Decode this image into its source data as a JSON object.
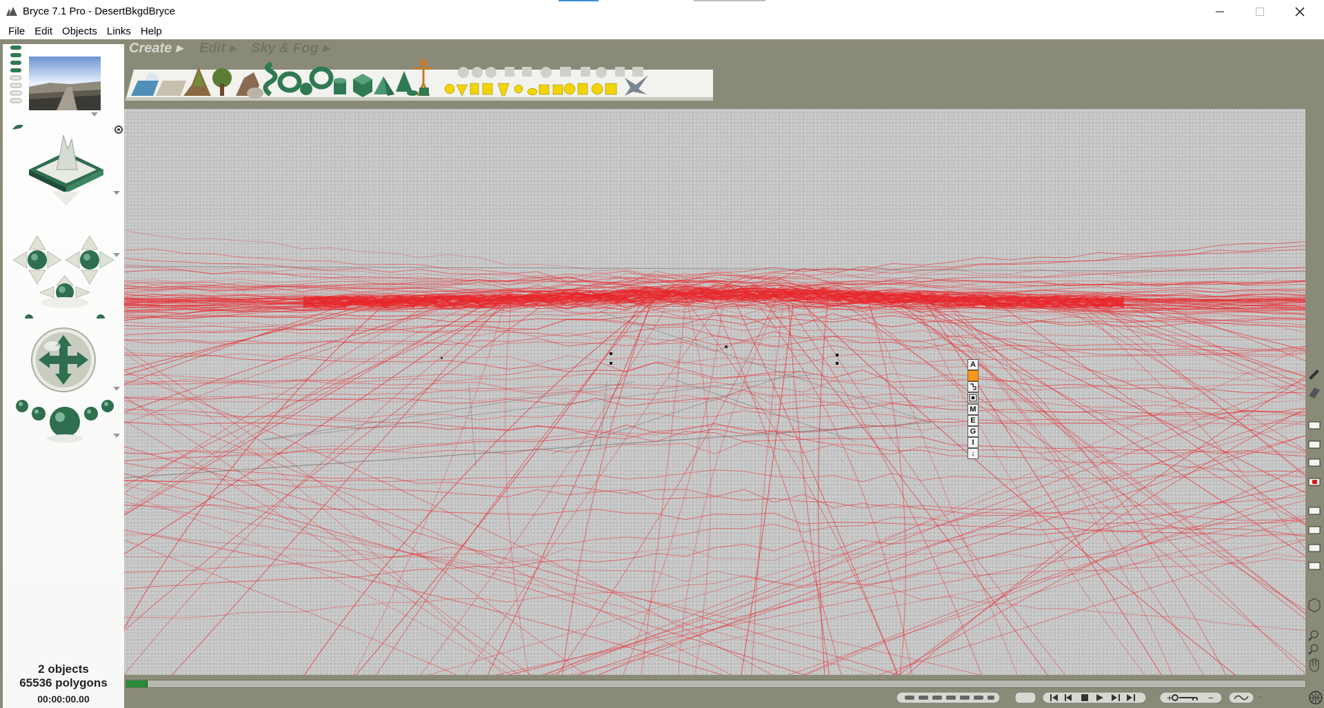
{
  "window": {
    "title": "Bryce 7.1  Pro - DesertBkgdBryce",
    "minimize_symbol": "—",
    "maximize_symbol": "☐",
    "close_symbol": "✕"
  },
  "menubar": {
    "items": [
      {
        "label": "File"
      },
      {
        "label": "Edit"
      },
      {
        "label": "Objects"
      },
      {
        "label": "Links"
      },
      {
        "label": "Help"
      }
    ]
  },
  "palette_tabs": {
    "create": "Create",
    "edit": "Edit",
    "sky_fog": "Sky & Fog"
  },
  "create_tray": {
    "items": [
      "water-plane",
      "ground-plane",
      "terrain",
      "tree",
      "rock",
      "metaball",
      "torus",
      "sphere",
      "cylinder",
      "cube",
      "pyramid",
      "cone",
      "human-figure",
      "disc",
      "square",
      "yellow-sphere",
      "yellow-cone",
      "yellow-cylinder",
      "yellow-cube",
      "yellow-pyramid",
      "yellow-sun",
      "yellow-disc",
      "yellow-slab",
      "yellow-square",
      "yellow-ring-ball",
      "yellow-box",
      "yellow-lattice",
      "yellow-grid-cube",
      "instance-lab"
    ]
  },
  "handle_labels": [
    "A",
    "",
    "",
    "",
    "M",
    "E",
    "G",
    "I",
    "↓"
  ],
  "status": {
    "objects": "2 objects",
    "polygons": "65536 polygons",
    "time": "00:00:00.00"
  },
  "colors": {
    "wireframe": "#e8262b",
    "grid": "#7f7f7f",
    "accent_orange": "#f59a1f",
    "palette_green": "#2f6e4f"
  }
}
